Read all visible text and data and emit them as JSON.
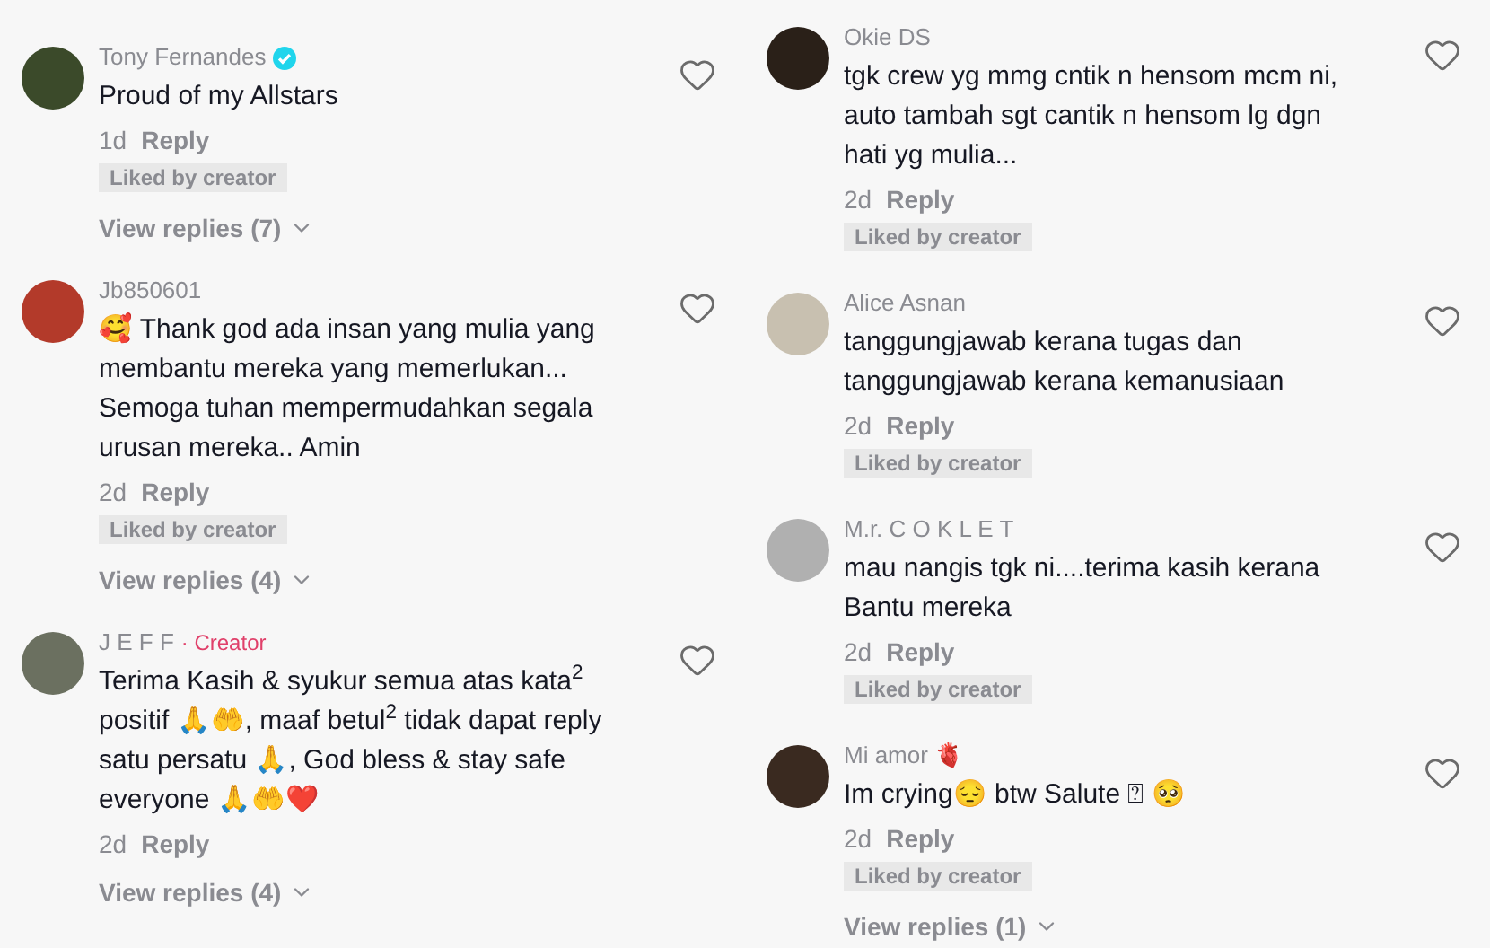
{
  "columns": [
    {
      "comments": [
        {
          "name": "Tony Fernandes",
          "verified": true,
          "lines": [
            "Proud of my Allstars"
          ],
          "time": "1d",
          "reply": "Reply",
          "liked": "Liked by creator",
          "view_replies": "View replies (7)"
        },
        {
          "name": "Jb850601",
          "verified": false,
          "lines": [
            "🥰 Thank god ada insan yang mulia yang",
            "membantu mereka yang memerlukan...",
            "Semoga tuhan mempermudahkan segala",
            "urusan mereka.. Amin"
          ],
          "time": "2d",
          "reply": "Reply",
          "liked": "Liked by creator",
          "view_replies": "View replies (4)"
        },
        {
          "name": "J E F F",
          "verified": false,
          "badge": "· Creator",
          "lines": [
            "Terima Kasih & syukur semua atas kata$^{2}$",
            "positif 🙏🤲, maaf betul$^{2}$ tidak dapat reply",
            "satu persatu 🙏, God bless & stay safe",
            "everyone 🙏🤲❤️"
          ],
          "time": "2d",
          "reply": "Reply",
          "view_replies": "View replies (4)"
        }
      ]
    },
    {
      "comments": [
        {
          "name": "Okie DS",
          "verified": false,
          "lines": [
            "tgk crew yg mmg cntik n hensom mcm ni,",
            "auto tambah sgt cantik n hensom lg dgn",
            "hati yg mulia..."
          ],
          "time": "2d",
          "reply": "Reply",
          "liked": "Liked by creator"
        },
        {
          "name": "Alice Asnan",
          "verified": false,
          "lines": [
            "tanggungjawab kerana tugas dan",
            "tanggungjawab kerana kemanusiaan"
          ],
          "time": "2d",
          "reply": "Reply",
          "liked": "Liked by creator"
        },
        {
          "name": "M.r. C O K L E T",
          "verified": false,
          "lines": [
            "mau nangis tgk ni....terima kasih kerana",
            "Bantu mereka"
          ],
          "time": "2d",
          "reply": "Reply",
          "liked": "Liked by creator"
        },
        {
          "name": "Mi amor 🫀",
          "verified": false,
          "lines": [
            "Im crying😔 btw Salute ⍰ 🥺"
          ],
          "time": "2d",
          "reply": "Reply",
          "liked": "Liked by creator",
          "view_replies": "View replies (1)"
        }
      ]
    }
  ]
}
